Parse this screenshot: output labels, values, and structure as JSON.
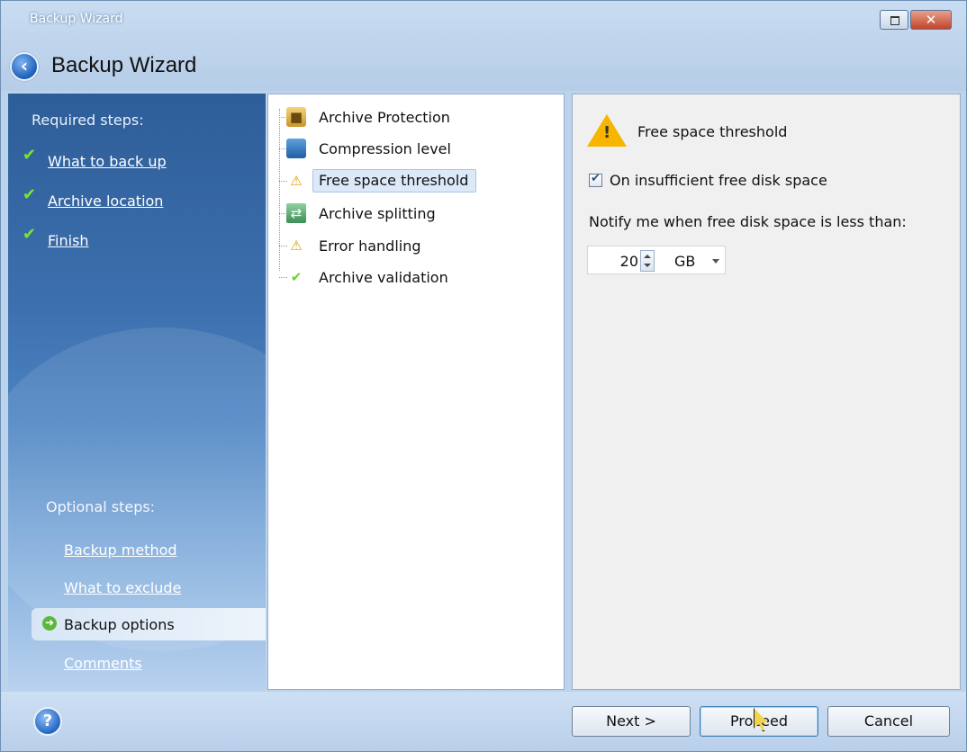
{
  "window": {
    "title_small": "Backup Wizard",
    "title_large": "Backup Wizard",
    "minimize_icon": "restore-icon",
    "close_glyph": "✕"
  },
  "sidebar": {
    "required_heading": "Required steps:",
    "required_steps": [
      {
        "label": "What to back up",
        "done": true
      },
      {
        "label": "Archive location",
        "done": true
      },
      {
        "label": "Finish",
        "done": true
      }
    ],
    "optional_heading": "Optional steps:",
    "optional_steps": [
      {
        "label": "Backup method"
      },
      {
        "label": "What to exclude"
      },
      {
        "label": "Backup options",
        "current": true
      },
      {
        "label": "Comments"
      }
    ]
  },
  "tree": {
    "items": [
      {
        "label": "Archive Protection",
        "icon": "lock-icon"
      },
      {
        "label": "Compression level",
        "icon": "compression-icon"
      },
      {
        "label": "Free space threshold",
        "icon": "warning-icon",
        "selected": true
      },
      {
        "label": "Archive splitting",
        "icon": "split-icon"
      },
      {
        "label": "Error handling",
        "icon": "warning-icon"
      },
      {
        "label": "Archive validation",
        "icon": "check-icon"
      }
    ]
  },
  "settings": {
    "title": "Free space threshold",
    "icon": "warning-icon",
    "checkbox_label": "On insufficient free disk space",
    "checkbox_checked": true,
    "notify_label": "Notify me when free disk space is less than:",
    "threshold_value": "20",
    "threshold_unit": "GB"
  },
  "footer": {
    "help_icon": "help-icon",
    "next_label": "Next >",
    "proceed_label": "Proceed",
    "cancel_label": "Cancel"
  }
}
